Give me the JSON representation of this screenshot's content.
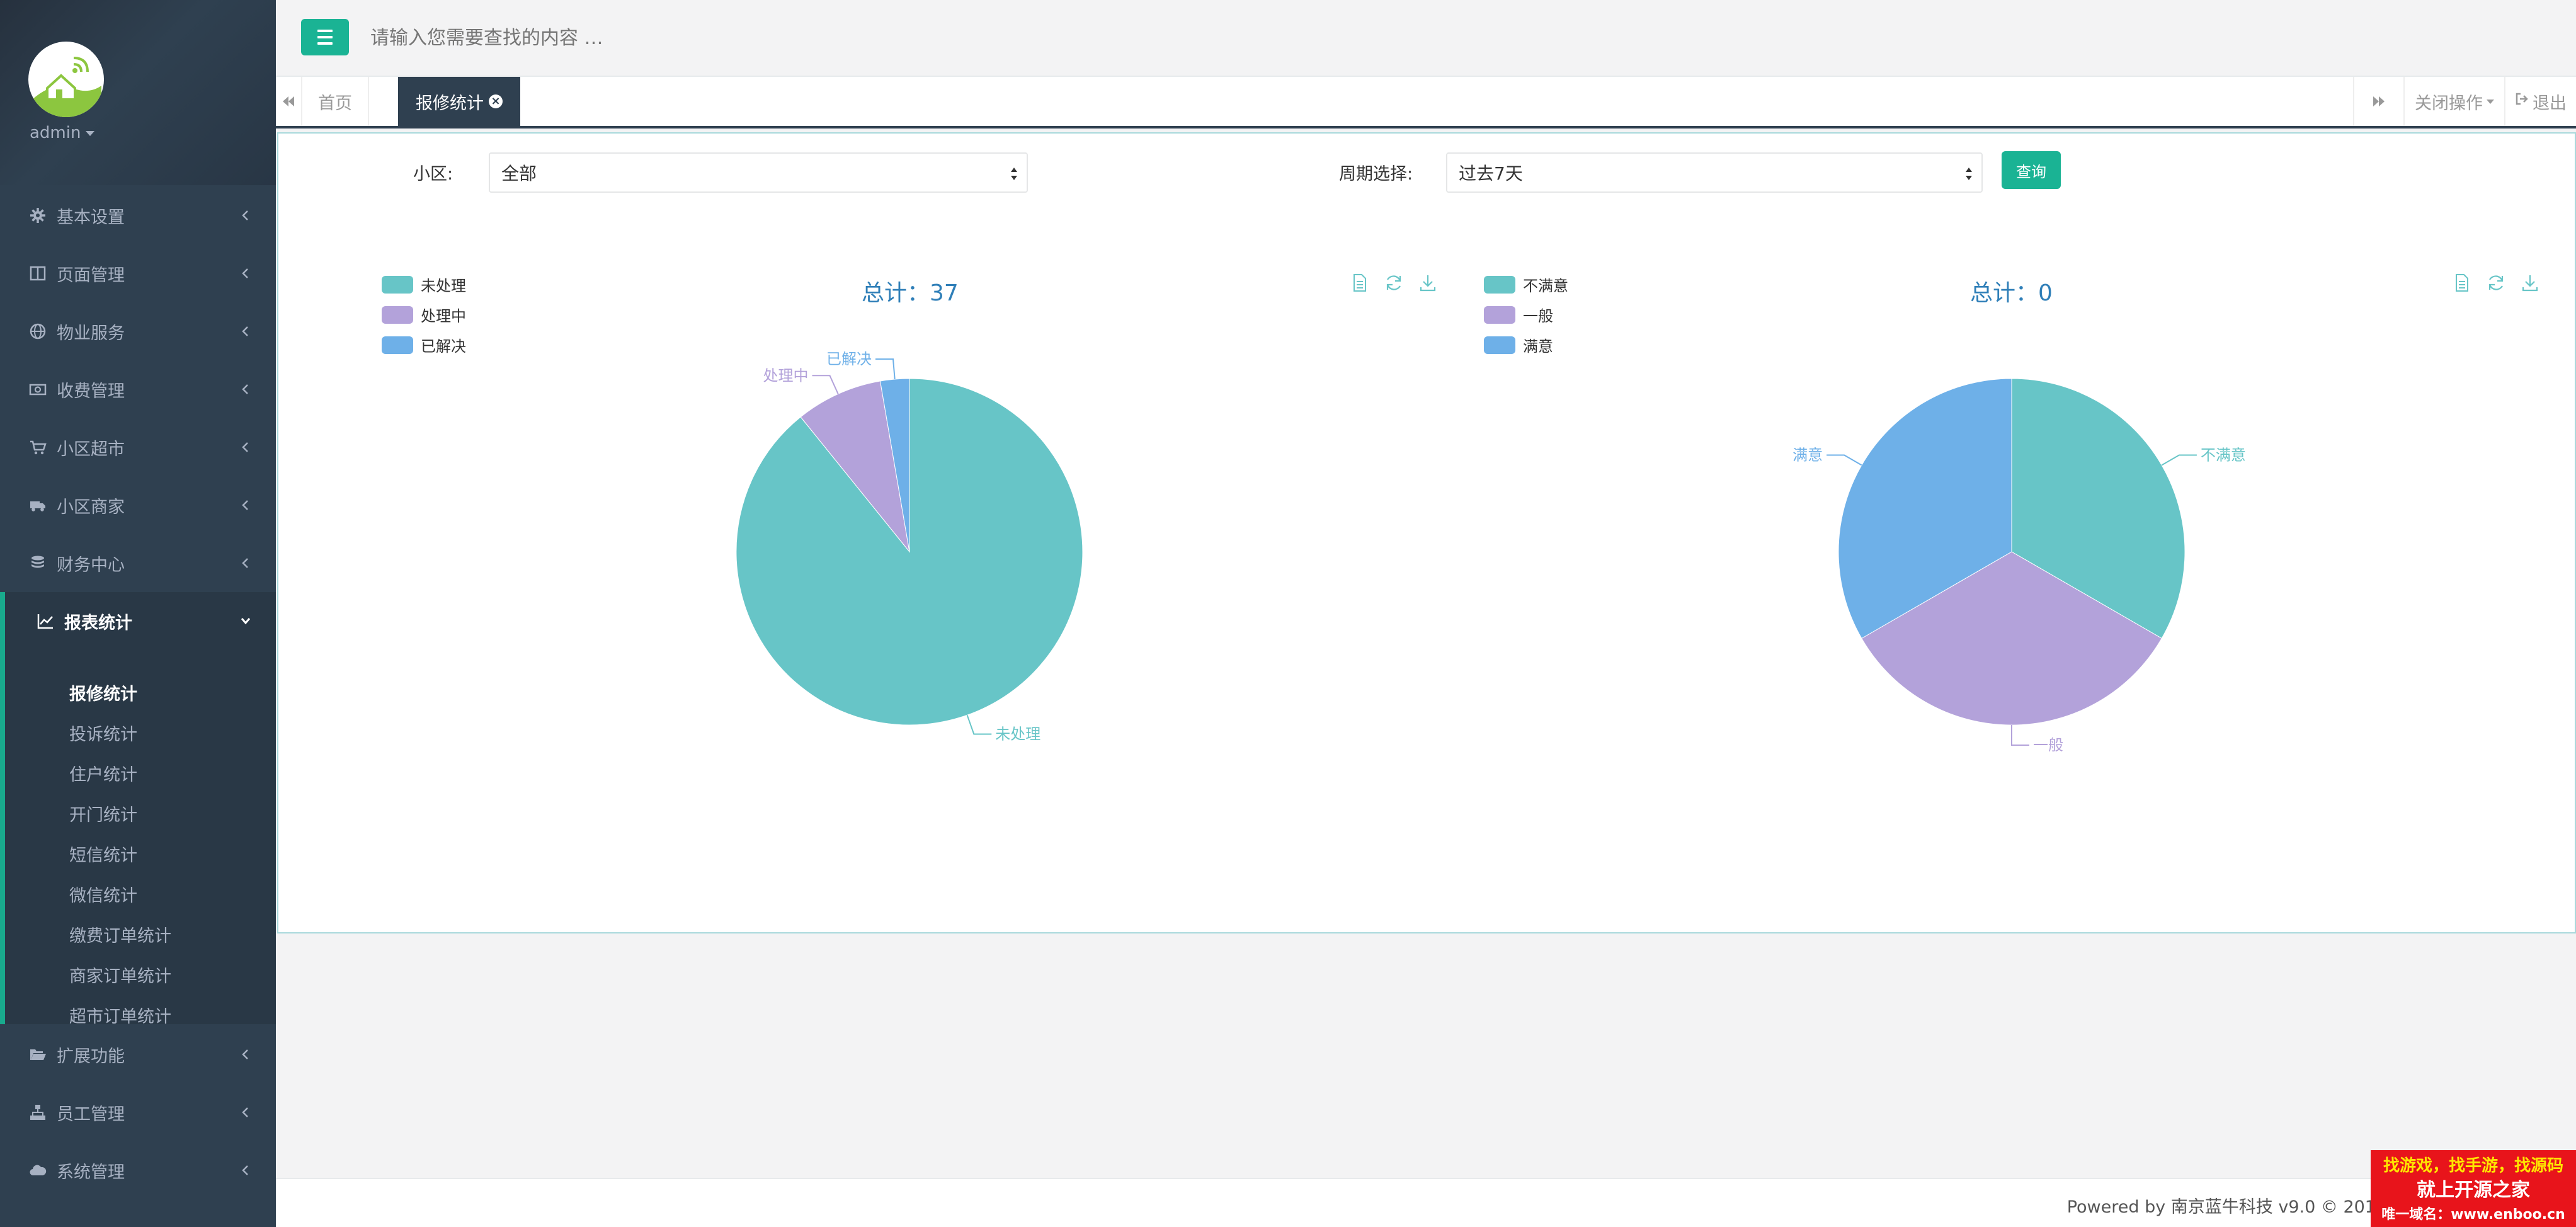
{
  "user": {
    "name": "admin"
  },
  "sidebar": {
    "menu": [
      {
        "label": "基本设置",
        "icon": "gear-icon"
      },
      {
        "label": "页面管理",
        "icon": "columns-icon"
      },
      {
        "label": "物业服务",
        "icon": "globe-icon"
      },
      {
        "label": "收费管理",
        "icon": "money-icon"
      },
      {
        "label": "小区超市",
        "icon": "cart-icon"
      },
      {
        "label": "小区商家",
        "icon": "truck-icon"
      },
      {
        "label": "财务中心",
        "icon": "database-icon"
      },
      {
        "label": "报表统计",
        "icon": "line-chart-icon"
      },
      {
        "label": "扩展功能",
        "icon": "folder-open-icon"
      },
      {
        "label": "员工管理",
        "icon": "sitemap-icon"
      },
      {
        "label": "系统管理",
        "icon": "cloud-icon"
      }
    ],
    "submenu": [
      "报修统计",
      "投诉统计",
      "住户统计",
      "开门统计",
      "短信统计",
      "微信统计",
      "缴费订单统计",
      "商家订单统计",
      "超市订单统计"
    ]
  },
  "topbar": {
    "search_placeholder": "请输入您需要查找的内容 …"
  },
  "tabs": {
    "home": "首页",
    "current": "报修统计",
    "close_ops": "关闭操作",
    "logout": "退出"
  },
  "filters": {
    "community_label": "小区:",
    "community_value": "全部",
    "period_label": "周期选择:",
    "period_value": "过去7天",
    "query_button": "查询"
  },
  "colors": {
    "teal": "#67c5c7",
    "purple": "#b3a2da",
    "blue": "#6eb0e8",
    "accent": "#1ab394",
    "sidebar": "#2f4050"
  },
  "chart_data": [
    {
      "type": "pie",
      "title": "总计：37",
      "legend": [
        "未处理",
        "处理中",
        "已解决"
      ],
      "legend_position": "top-left",
      "series": [
        {
          "name": "未处理",
          "value": 33,
          "color": "#67c5c7"
        },
        {
          "name": "处理中",
          "value": 3,
          "color": "#b3a2da"
        },
        {
          "name": "已解决",
          "value": 1,
          "color": "#6eb0e8"
        }
      ]
    },
    {
      "type": "pie",
      "title": "总计：0",
      "legend": [
        "不满意",
        "一般",
        "满意"
      ],
      "legend_position": "top-left",
      "series": [
        {
          "name": "不满意",
          "value": 0,
          "color": "#67c5c7"
        },
        {
          "name": "一般",
          "value": 0,
          "color": "#b3a2da"
        },
        {
          "name": "满意",
          "value": 0,
          "color": "#6eb0e8"
        }
      ]
    }
  ],
  "footer": {
    "powered": "Powered by 南京蓝牛科技 v9.0 © 201",
    "watermark_line1": "找游戏，找手游，找源码",
    "watermark_line2": "就上开源之家",
    "watermark_line3": "唯一域名：www.enboo.cn"
  }
}
